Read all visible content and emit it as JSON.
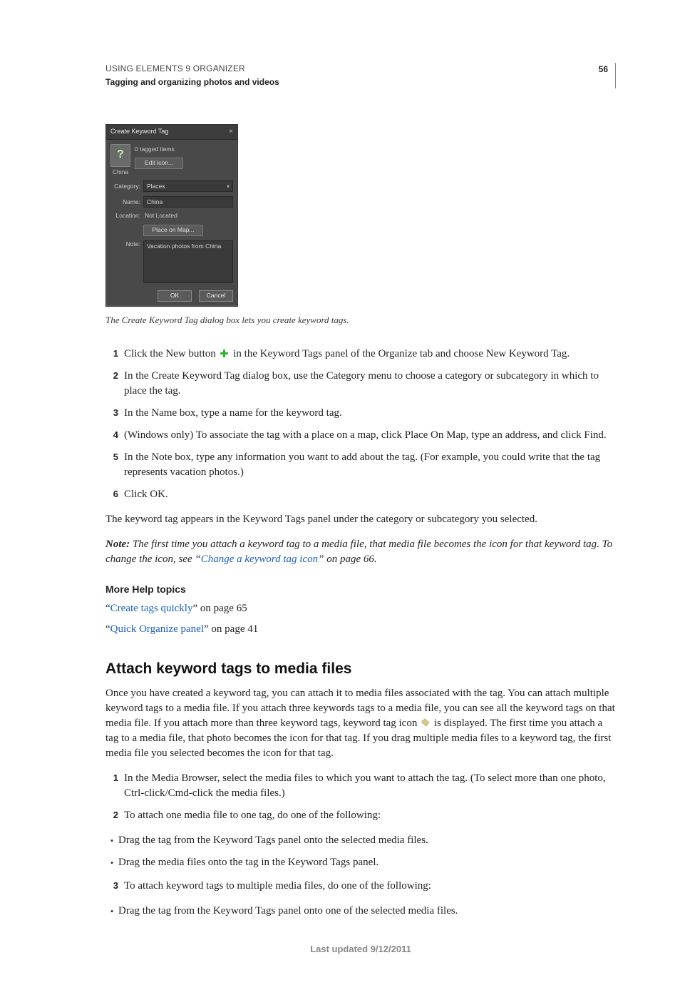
{
  "header": {
    "title": "USING ELEMENTS 9 ORGANIZER",
    "section": "Tagging and organizing photos and videos",
    "page": "56"
  },
  "dialog": {
    "title": "Create Keyword Tag",
    "close": "×",
    "tagged_items": "0 tagged items",
    "icon_label": "China",
    "edit_icon": "Edit Icon...",
    "category_label": "Category:",
    "category_value": "Places",
    "name_label": "Name:",
    "name_value": "China",
    "location_label": "Location:",
    "location_value": "Not Located",
    "place_on_map": "Place on Map...",
    "note_label": "Note:",
    "note_value": "Vacation photos from China",
    "ok": "OK",
    "cancel": "Cancel"
  },
  "caption": "The Create Keyword Tag dialog box lets you create keyword tags.",
  "steps": [
    {
      "n": "1",
      "before": "Click the New button ",
      "after": " in the Keyword Tags panel of the Organize tab and choose New Keyword Tag."
    },
    {
      "n": "2",
      "text": "In the Create Keyword Tag dialog box, use the Category menu to choose a category or subcategory in which to place the tag."
    },
    {
      "n": "3",
      "text": "In the Name box, type a name for the keyword tag."
    },
    {
      "n": "4",
      "text": "(Windows only) To associate the tag with a place on a map, click Place On Map, type an address, and click Find."
    },
    {
      "n": "5",
      "text": "In the Note box, type any information you want to add about the tag. (For example, you could write that the tag represents vacation photos.)"
    },
    {
      "n": "6",
      "text": "Click OK."
    }
  ],
  "after_steps": "The keyword tag appears in the Keyword Tags panel under the category or subcategory you selected.",
  "note": {
    "label": "Note: ",
    "body_before": "The first time you attach a keyword tag to a media file, that media file becomes the icon for that keyword tag. To change the icon, see “",
    "link": "Change a keyword tag icon",
    "body_after": "” on page 66."
  },
  "more_help_heading": "More Help topics",
  "more_help": [
    {
      "q": "“",
      "link": "Create tags quickly",
      "after": "” on page 65"
    },
    {
      "q": "“",
      "link": "Quick Organize panel",
      "after": "” on page 41"
    }
  ],
  "h2": "Attach keyword tags to media files",
  "attach_para_before": "Once you have created a keyword tag, you can attach it to media files associated with the tag. You can attach multiple keyword tags to a media file. If you attach three keywords tags to a media file, you can see all the keyword tags on that media file. If you attach more than three keyword tags, keyword tag icon ",
  "attach_para_after": " is displayed. The first time you attach a tag to a media file, that photo becomes the icon for that tag. If you drag multiple media files to a keyword tag, the first media file you selected becomes the icon for that tag.",
  "steps2": [
    {
      "n": "1",
      "text": "In the Media Browser, select the media files to which you want to attach the tag. (To select more than one photo, Ctrl-click/Cmd-click the media files.)"
    },
    {
      "n": "2",
      "text": "To attach one media file to one tag, do one of the following:"
    }
  ],
  "bullets2a": [
    "Drag the tag from the Keyword Tags panel onto the selected media files.",
    "Drag the media files onto the tag in the Keyword Tags panel."
  ],
  "steps2b": [
    {
      "n": "3",
      "text": "To attach keyword tags to multiple media files, do one of the following:"
    }
  ],
  "bullets2b": [
    "Drag the tag from the Keyword Tags panel onto one of the selected media files."
  ],
  "footer": "Last updated 9/12/2011"
}
